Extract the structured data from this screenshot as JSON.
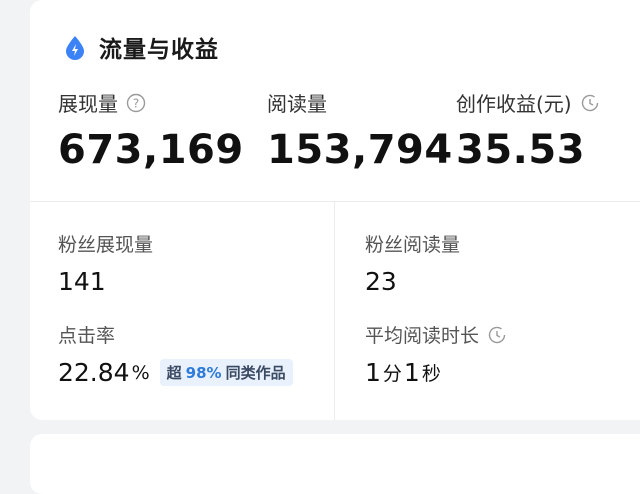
{
  "section": {
    "title": "流量与收益",
    "accent_color": "#3b82f6"
  },
  "metrics": [
    {
      "label": "展现量",
      "value": "673,169",
      "icon": "question-circle-icon"
    },
    {
      "label": "阅读量",
      "value": "153,794"
    },
    {
      "label": "创作收益(元)",
      "value": "35.53",
      "icon": "clock-icon"
    }
  ],
  "fans_impressions": {
    "label": "粉丝展现量",
    "value": "141"
  },
  "fans_reads": {
    "label": "粉丝阅读量",
    "value": "23"
  },
  "ctr": {
    "label": "点击率",
    "value": "22.84",
    "unit": "%",
    "badge_prefix": "超",
    "badge_value": "98%",
    "badge_suffix": "同类作品"
  },
  "avg_read_time": {
    "label": "平均阅读时长",
    "icon": "clock-icon",
    "minutes": "1",
    "min_unit": "分",
    "seconds": "1",
    "sec_unit": "秒"
  }
}
